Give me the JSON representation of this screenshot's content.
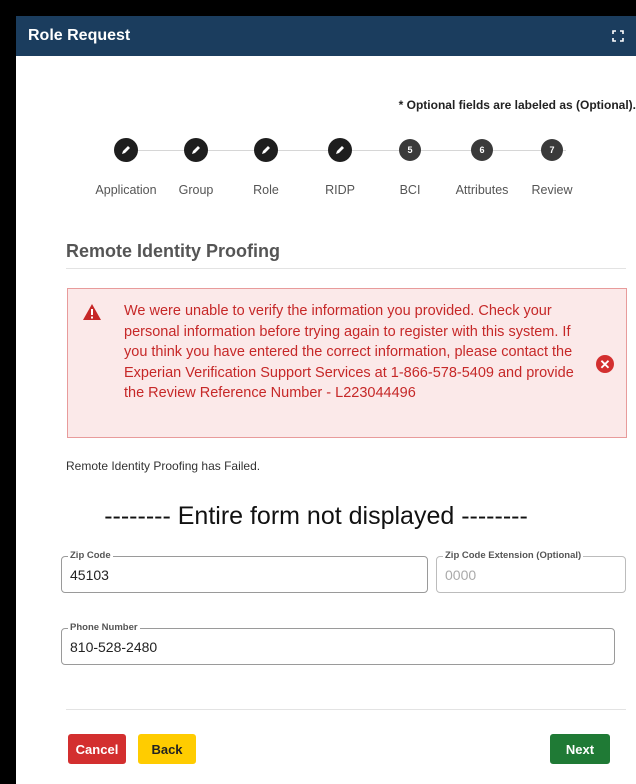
{
  "window": {
    "title": "Role Request",
    "expand_icon": "fullscreen-icon"
  },
  "optional_note": "* Optional fields are labeled as (Optional).",
  "stepper": {
    "steps": [
      {
        "label": "Application",
        "status": "done",
        "marker": ""
      },
      {
        "label": "Group",
        "status": "done",
        "marker": ""
      },
      {
        "label": "Role",
        "status": "done",
        "marker": ""
      },
      {
        "label": "RIDP",
        "status": "done",
        "marker": ""
      },
      {
        "label": "BCI",
        "status": "pending",
        "marker": "5"
      },
      {
        "label": "Attributes",
        "status": "pending",
        "marker": "6"
      },
      {
        "label": "Review",
        "status": "pending",
        "marker": "7"
      }
    ]
  },
  "section_title": "Remote Identity Proofing",
  "alert": {
    "message": "We were unable to verify the information you provided. Check your personal information before trying again to register with this system. If you think you have entered the correct information, please contact the Experian Verification Support Services at 1-866-578-5409 and provide the Review Reference Number - L223044496",
    "icon": "warning-icon",
    "close_icon": "close-circle-icon"
  },
  "status_text": "Remote Identity Proofing has Failed.",
  "form_note": "-------- Entire form not displayed --------",
  "fields": {
    "zip_code": {
      "label": "Zip Code",
      "value": "45103"
    },
    "zip_ext": {
      "label": "Zip Code Extension (Optional)",
      "value": "",
      "placeholder": "0000"
    },
    "phone": {
      "label": "Phone Number",
      "value": "810-528-2480"
    }
  },
  "buttons": {
    "cancel": "Cancel",
    "back": "Back",
    "next": "Next"
  },
  "colors": {
    "titlebar": "#1b3d5e",
    "alert_text": "#c62828",
    "cancel": "#d32f2f",
    "back": "#ffcc00",
    "next": "#1f7a35"
  }
}
